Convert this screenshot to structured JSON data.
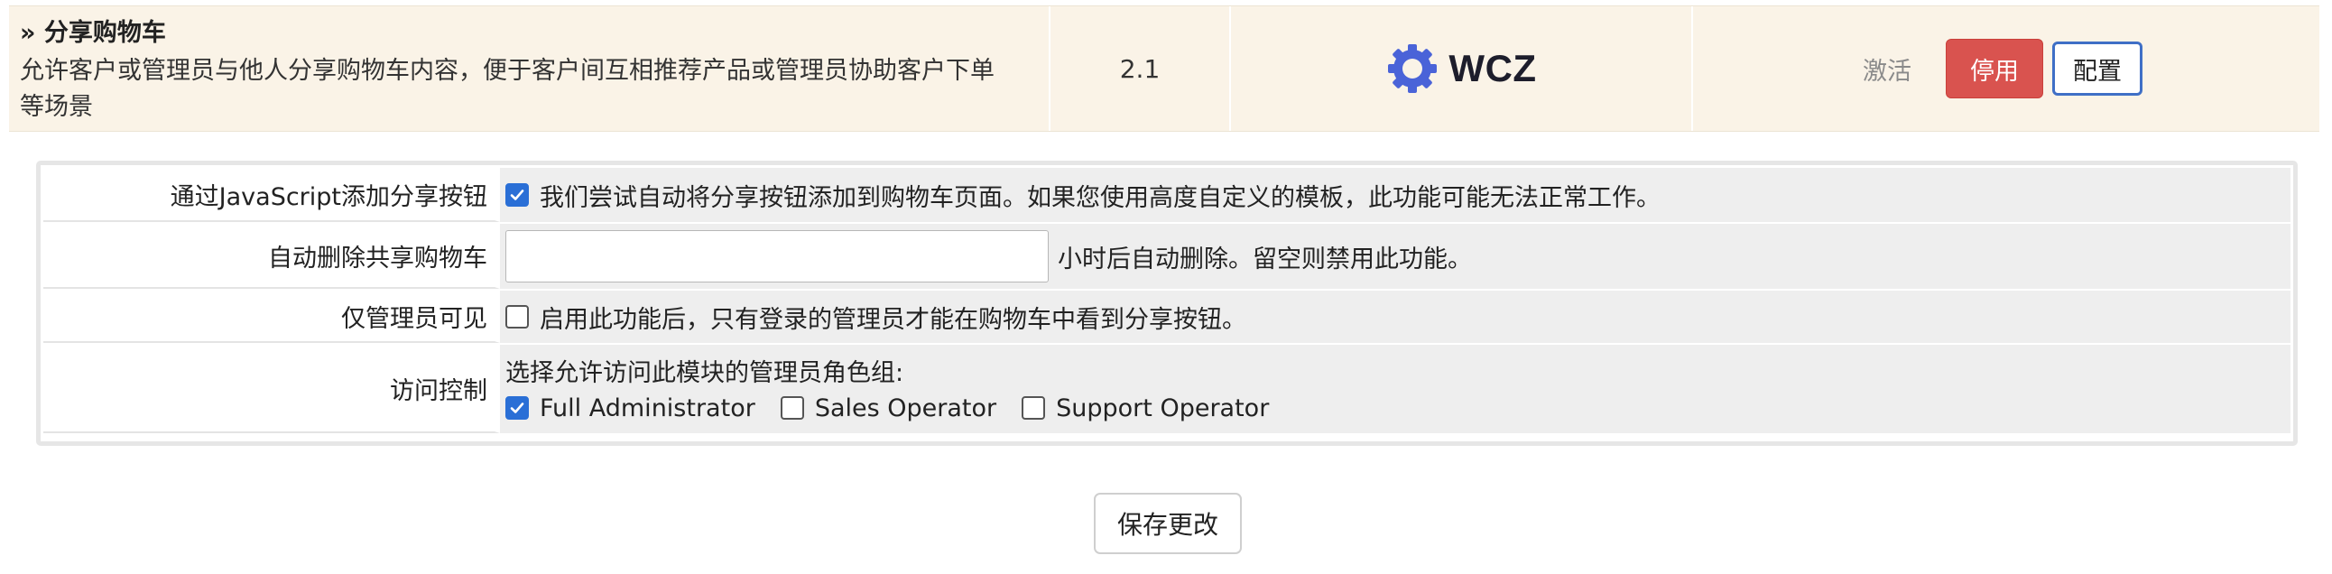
{
  "module": {
    "title": "» 分享购物车",
    "description_line1": "允许客户或管理员与他人分享购物车内容，便于客户间互相推荐产品或管理员协助客户下单",
    "description_line2": "等场景",
    "version": "2.1",
    "logo_text": "WCZ",
    "status_text": "激活",
    "disable_label": "停用",
    "config_label": "配置"
  },
  "config": {
    "js_share": {
      "label": "通过JavaScript添加分享按钮",
      "checked": true,
      "text": "我们尝试自动将分享按钮添加到购物车页面。如果您使用高度自定义的模板，此功能可能无法正常工作。"
    },
    "auto_delete": {
      "label": "自动删除共享购物车",
      "value": "",
      "placeholder": "",
      "suffix": "小时后自动删除。留空则禁用此功能。"
    },
    "admin_only": {
      "label": "仅管理员可见",
      "checked": false,
      "text": "启用此功能后，只有登录的管理员才能在购物车中看到分享按钮。"
    },
    "access_control": {
      "label": "访问控制",
      "prompt": "选择允许访问此模块的管理员角色组:",
      "roles": [
        {
          "name": "Full Administrator",
          "checked": true
        },
        {
          "name": "Sales Operator",
          "checked": false
        },
        {
          "name": "Support Operator",
          "checked": false
        }
      ]
    }
  },
  "save_label": "保存更改",
  "colors": {
    "row_bg": "#faf3e7",
    "disable_btn": "#d9534f",
    "config_btn_border": "#3f6fc6",
    "checkbox_checked": "#2a6fd6",
    "logo_gear": "#4a63d8"
  },
  "icons": {
    "logo": "gear-logo-icon",
    "check": "checkmark-icon"
  }
}
